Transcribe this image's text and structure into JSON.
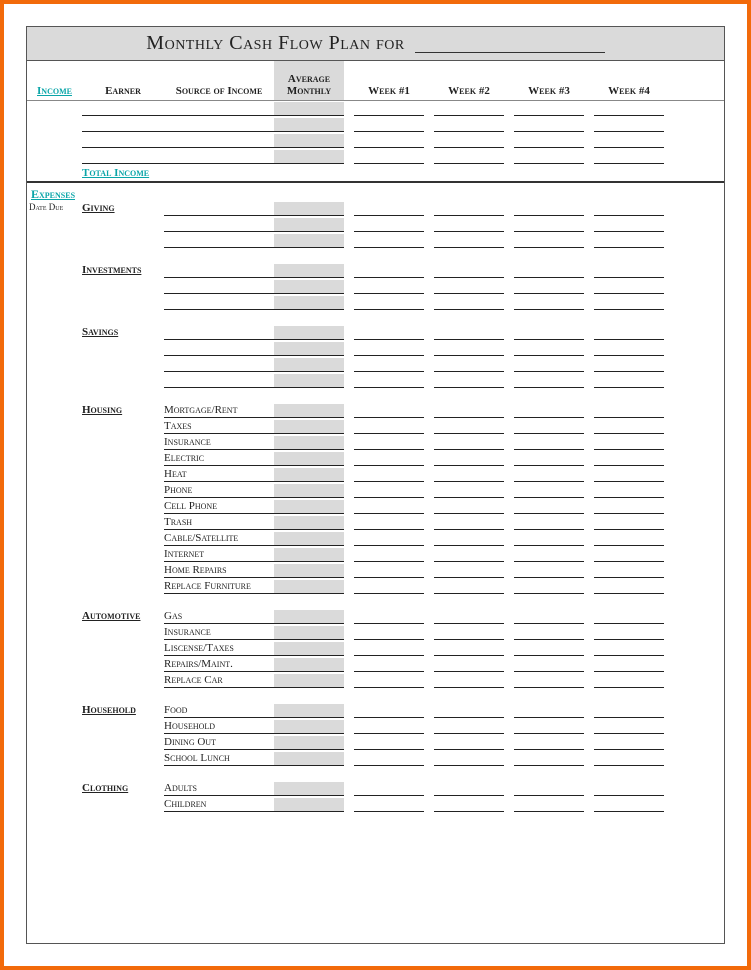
{
  "title": "Monthly Cash Flow Plan for",
  "headers": {
    "income": "Income",
    "earner": "Earner",
    "source": "Source of Income",
    "avg": "Average Monthly",
    "wk1": "Week #1",
    "wk2": "Week #2",
    "wk3": "Week #3",
    "wk4": "Week #4"
  },
  "total_income": "Total Income",
  "expenses_label": "Expenses",
  "date_due": "Date Due",
  "sections": [
    {
      "name": "Giving",
      "items": [
        "",
        "",
        ""
      ]
    },
    {
      "name": "Investments",
      "items": [
        "",
        "",
        ""
      ]
    },
    {
      "name": "Savings",
      "items": [
        "",
        "",
        "",
        ""
      ]
    },
    {
      "name": "Housing",
      "items": [
        "Mortgage/Rent",
        "Taxes",
        "Insurance",
        "Electric",
        "Heat",
        "Phone",
        "Cell Phone",
        "Trash",
        "Cable/Satellite",
        "Internet",
        "Home Repairs",
        "Replace Furniture"
      ]
    },
    {
      "name": "Automotive",
      "items": [
        "Gas",
        "Insurance",
        "Liscense/Taxes",
        "Repairs/Maint.",
        "Replace Car"
      ]
    },
    {
      "name": "Household",
      "items": [
        "Food",
        "Household",
        "Dining Out",
        "School Lunch"
      ]
    },
    {
      "name": "Clothing",
      "items": [
        "Adults",
        "Children"
      ]
    }
  ],
  "income_rows": 4
}
